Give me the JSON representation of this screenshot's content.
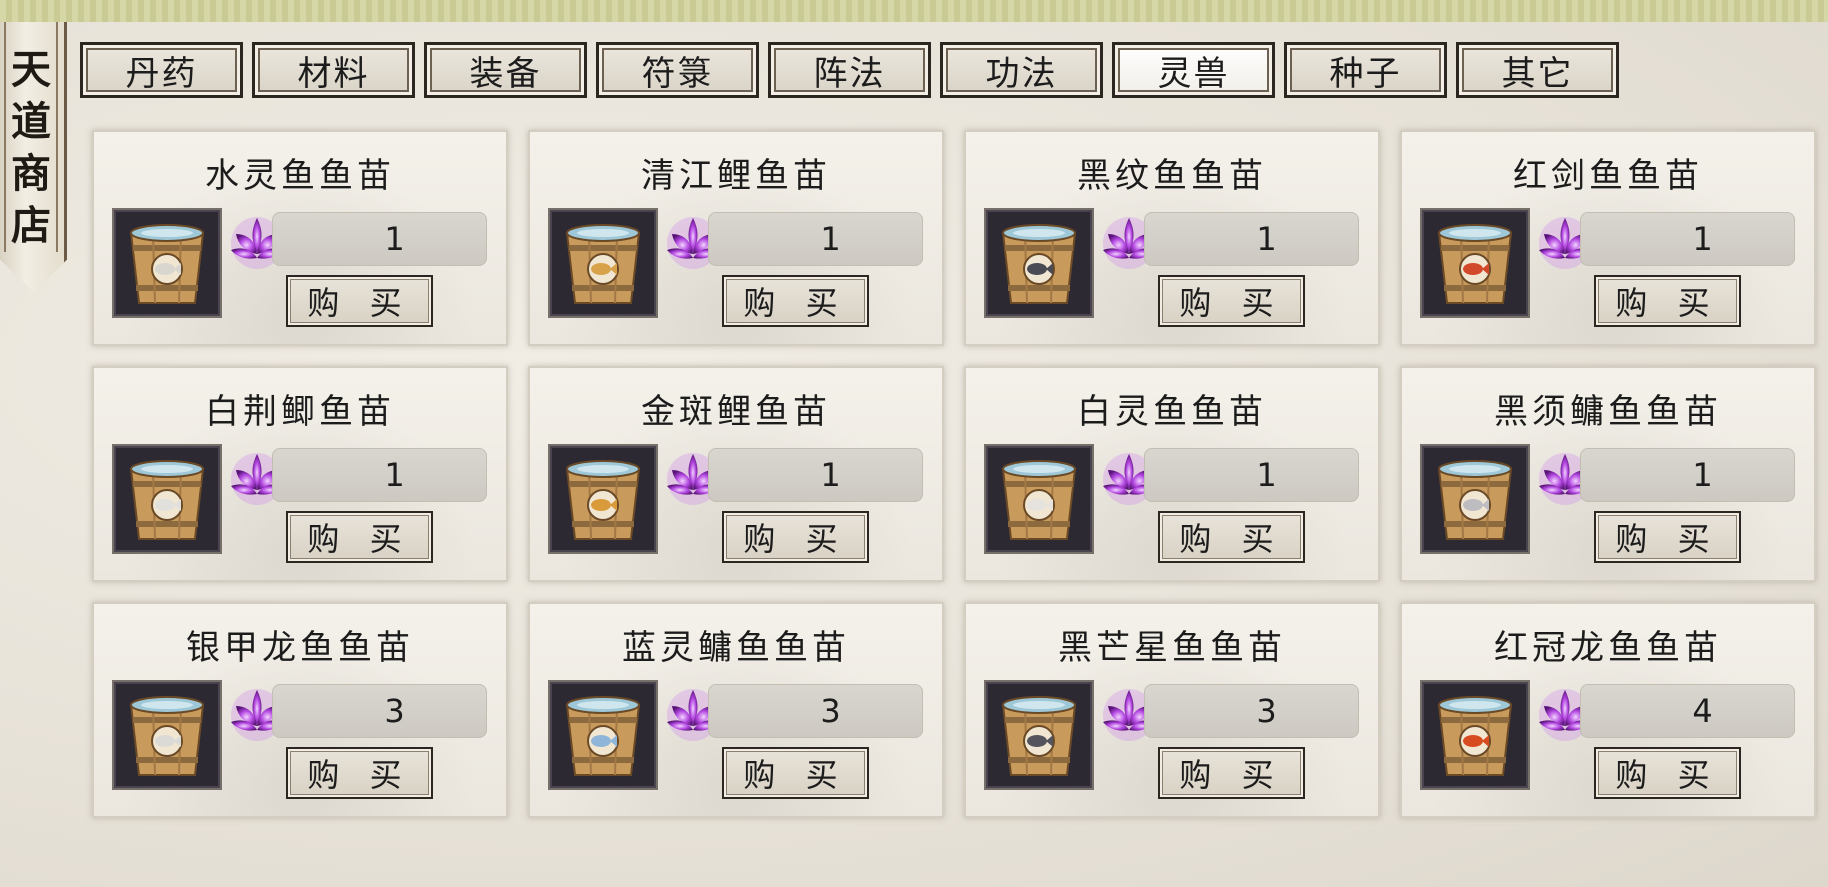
{
  "shop": {
    "title": "天道商店"
  },
  "tabs": [
    {
      "label": "丹药",
      "active": false
    },
    {
      "label": "材料",
      "active": false
    },
    {
      "label": "装备",
      "active": false
    },
    {
      "label": "符箓",
      "active": false
    },
    {
      "label": "阵法",
      "active": false
    },
    {
      "label": "功法",
      "active": false
    },
    {
      "label": "灵兽",
      "active": true
    },
    {
      "label": "种子",
      "active": false
    },
    {
      "label": "其它",
      "active": false
    }
  ],
  "currency_icon": "purple-lotus-icon",
  "buy_label": "购 买",
  "items": [
    {
      "name": "水灵鱼鱼苗",
      "price": "1",
      "fish_color": "#d9d6d0"
    },
    {
      "name": "清江鲤鱼苗",
      "price": "1",
      "fish_color": "#d8a24a"
    },
    {
      "name": "黑纹鱼鱼苗",
      "price": "1",
      "fish_color": "#4a4a55"
    },
    {
      "name": "红剑鱼鱼苗",
      "price": "1",
      "fish_color": "#d2482a"
    },
    {
      "name": "白荆鲫鱼苗",
      "price": "1",
      "fish_color": "#e2e0dc"
    },
    {
      "name": "金斑鲤鱼苗",
      "price": "1",
      "fish_color": "#d99a3a"
    },
    {
      "name": "白灵鱼鱼苗",
      "price": "1",
      "fish_color": "#e6e3de"
    },
    {
      "name": "黑须鳙鱼鱼苗",
      "price": "1",
      "fish_color": "#bdbcc0"
    },
    {
      "name": "银甲龙鱼鱼苗",
      "price": "3",
      "fish_color": "#dcdad6"
    },
    {
      "name": "蓝灵鳙鱼鱼苗",
      "price": "3",
      "fish_color": "#8fb6d8"
    },
    {
      "name": "黑芒星鱼鱼苗",
      "price": "3",
      "fish_color": "#55535c"
    },
    {
      "name": "红冠龙鱼鱼苗",
      "price": "4",
      "fish_color": "#d84a20"
    }
  ]
}
